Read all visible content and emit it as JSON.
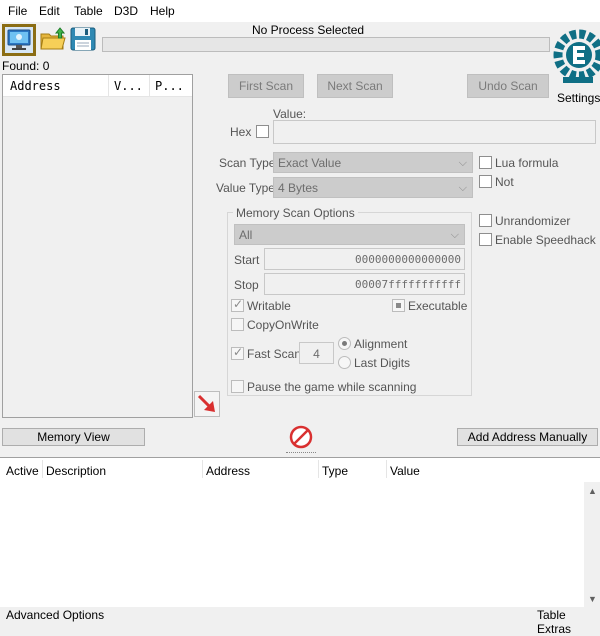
{
  "menu": [
    "File",
    "Edit",
    "Table",
    "D3D",
    "Help"
  ],
  "toolbar": {
    "open_process_icon": "computer-icon",
    "open_file_icon": "folder-open-icon",
    "save_icon": "floppy-disk-icon"
  },
  "process_title": "No Process Selected",
  "found": "Found: 0",
  "found_list_columns": [
    "Address",
    "V...",
    "P..."
  ],
  "buttons": {
    "first_scan": "First Scan",
    "next_scan": "Next Scan",
    "undo_scan": "Undo Scan",
    "memory_view": "Memory View",
    "add_address": "Add Address Manually"
  },
  "settings_label": "Settings",
  "value_label": "Value:",
  "hex_label": "Hex",
  "scan_type": {
    "label": "Scan Type",
    "value": "Exact Value"
  },
  "value_type": {
    "label": "Value Type",
    "value": "4 Bytes"
  },
  "right_options": {
    "lua_formula": "Lua formula",
    "not": "Not",
    "unrandomizer": "Unrandomizer",
    "speedhack": "Enable Speedhack"
  },
  "memory_scan": {
    "title": "Memory Scan Options",
    "region": "All",
    "start_label": "Start",
    "start_value": "0000000000000000",
    "stop_label": "Stop",
    "stop_value": "00007fffffffffff",
    "writable": "Writable",
    "executable": "Executable",
    "copy_on_write": "CopyOnWrite",
    "fast_scan": "Fast Scan",
    "fast_scan_value": "4",
    "alignment": "Alignment",
    "last_digits": "Last Digits",
    "pause": "Pause the game while scanning"
  },
  "table_columns": [
    "Active",
    "Description",
    "Address",
    "Type",
    "Value"
  ],
  "bottom_left": "Advanced Options",
  "bottom_right": "Table Extras",
  "colors": {
    "accent_red": "#d93030",
    "logo_teal": "#0f6f85",
    "selected_border": "#8b6d14"
  }
}
